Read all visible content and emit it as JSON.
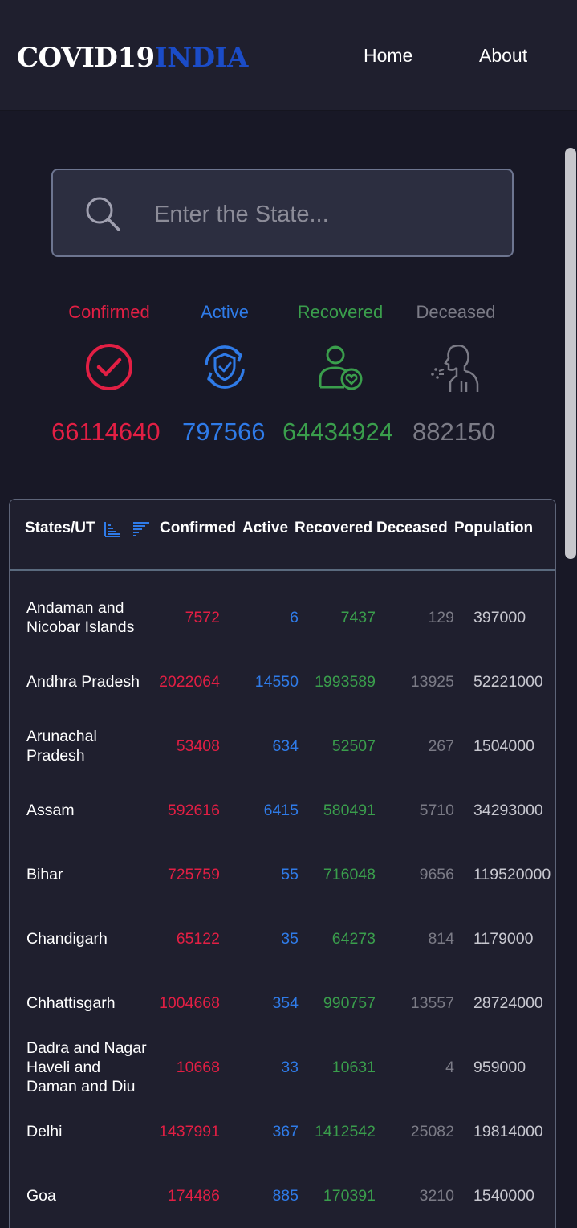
{
  "header": {
    "logo_part1": "COVID19",
    "logo_part2": "INDIA",
    "nav": [
      "Home",
      "About"
    ]
  },
  "search": {
    "placeholder": "Enter the State...",
    "icon": "search-icon"
  },
  "stats": [
    {
      "label": "Confirmed",
      "value": "66114640",
      "color": "#e21f44",
      "icon": "check-circle-icon"
    },
    {
      "label": "Active",
      "value": "797566",
      "color": "#2f7be8",
      "icon": "shield-refresh-icon"
    },
    {
      "label": "Recovered",
      "value": "64434924",
      "color": "#3a9e4c",
      "icon": "person-heart-icon"
    },
    {
      "label": "Deceased",
      "value": "882150",
      "color": "#7b7b86",
      "icon": "person-coughing-icon"
    }
  ],
  "table": {
    "headers": [
      "States/UT",
      "Confirmed",
      "Active",
      "Recovered",
      "Deceased",
      "Population"
    ],
    "rows": [
      {
        "state": "Andaman and Nicobar Islands",
        "confirmed": "7572",
        "active": "6",
        "recovered": "7437",
        "deceased": "129",
        "population": "397000"
      },
      {
        "state": "Andhra Pradesh",
        "confirmed": "2022064",
        "active": "14550",
        "recovered": "1993589",
        "deceased": "13925",
        "population": "52221000"
      },
      {
        "state": "Arunachal Pradesh",
        "confirmed": "53408",
        "active": "634",
        "recovered": "52507",
        "deceased": "267",
        "population": "1504000"
      },
      {
        "state": "Assam",
        "confirmed": "592616",
        "active": "6415",
        "recovered": "580491",
        "deceased": "5710",
        "population": "34293000"
      },
      {
        "state": "Bihar",
        "confirmed": "725759",
        "active": "55",
        "recovered": "716048",
        "deceased": "9656",
        "population": "119520000"
      },
      {
        "state": "Chandigarh",
        "confirmed": "65122",
        "active": "35",
        "recovered": "64273",
        "deceased": "814",
        "population": "1179000"
      },
      {
        "state": "Chhattisgarh",
        "confirmed": "1004668",
        "active": "354",
        "recovered": "990757",
        "deceased": "13557",
        "population": "28724000"
      },
      {
        "state": "Dadra and Nagar Haveli and Daman and Diu",
        "confirmed": "10668",
        "active": "33",
        "recovered": "10631",
        "deceased": "4",
        "population": "959000"
      },
      {
        "state": "Delhi",
        "confirmed": "1437991",
        "active": "367",
        "recovered": "1412542",
        "deceased": "25082",
        "population": "19814000"
      },
      {
        "state": "Goa",
        "confirmed": "174486",
        "active": "885",
        "recovered": "170391",
        "deceased": "3210",
        "population": "1540000"
      }
    ]
  }
}
